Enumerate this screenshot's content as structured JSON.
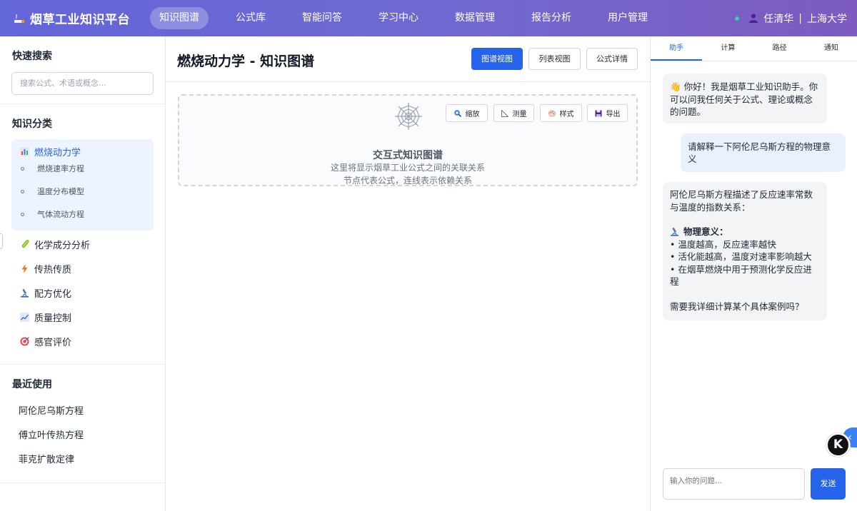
{
  "header": {
    "brand_title": "烟草工业知识平台",
    "nav": [
      {
        "label": "知识图谱",
        "active": true
      },
      {
        "label": "公式库"
      },
      {
        "label": "智能问答"
      },
      {
        "label": "学习中心"
      },
      {
        "label": "数据管理"
      },
      {
        "label": "报告分析"
      },
      {
        "label": "用户管理"
      }
    ],
    "user_name": "任清华",
    "separator": "|",
    "organization": "上海大学",
    "status_color": "#34d399"
  },
  "sidebar": {
    "quick_search_title": "快速搜索",
    "search_placeholder": "搜索公式、术语或概念...",
    "categories_title": "知识分类",
    "active_category": {
      "label": "燃烧动力学",
      "icon": "bar-chart-icon",
      "subitems": [
        "燃烧速率方程",
        "温度分布模型",
        "气体流动方程"
      ]
    },
    "categories": [
      {
        "label": "化学成分分析",
        "icon": "test-tube-icon"
      },
      {
        "label": "传热传质",
        "icon": "lightning-icon"
      },
      {
        "label": "配方优化",
        "icon": "microscope-icon"
      },
      {
        "label": "质量控制",
        "icon": "line-chart-icon"
      },
      {
        "label": "感官评价",
        "icon": "target-icon"
      }
    ],
    "recent_title": "最近使用",
    "recent": [
      "阿伦尼乌斯方程",
      "傅立叶传热方程",
      "菲克扩散定律"
    ]
  },
  "main": {
    "title": "燃烧动力学 - 知识图谱",
    "view_buttons": [
      "图谱视图",
      "列表视图",
      "公式详情"
    ],
    "tools": [
      {
        "label": "缩放",
        "icon": "magnifier-icon"
      },
      {
        "label": "测量",
        "icon": "ruler-icon"
      },
      {
        "label": "样式",
        "icon": "palette-icon"
      },
      {
        "label": "导出",
        "icon": "floppy-disk-icon"
      }
    ],
    "graph_title": "交互式知识图谱",
    "graph_line1": "这里将显示烟草工业公式之间的关联关系",
    "graph_line2": "节点代表公式，连线表示依赖关系"
  },
  "assistant": {
    "tabs": [
      "助手",
      "计算",
      "路径",
      "通知"
    ],
    "messages": [
      {
        "role": "bot",
        "emoji": "👋",
        "text": "你好！我是烟草工业知识助手。你可以问我任何关于公式、理论或概念的问题。"
      },
      {
        "role": "user",
        "text": "请解释一下阿伦尼乌斯方程的物理意义"
      },
      {
        "role": "bot",
        "intro": "阿伦尼乌斯方程描述了反应速率常数与温度的指数关系：",
        "heading": "物理意义：",
        "bullets": [
          "• 温度越高，反应速率越快",
          "• 活化能越高，温度对速率影响越大",
          "• 在烟草燃烧中用于预测化学反应进程"
        ],
        "closing": "需要我详细计算某个具体案例吗？"
      }
    ],
    "input_placeholder": "输入你的问题...",
    "send_label": "发送",
    "collapse_glyph": "‹",
    "badge_letter": "K"
  }
}
